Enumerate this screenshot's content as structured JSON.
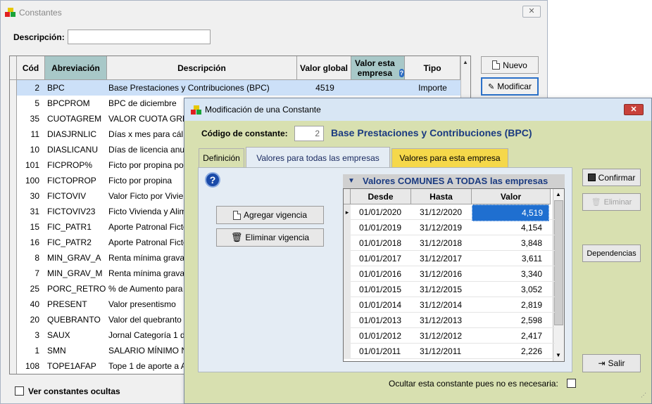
{
  "main_window": {
    "title": "Constantes",
    "descripcion_label": "Descripción:",
    "descripcion_value": "",
    "columns": [
      "Cód",
      "Abreviación",
      "Descripción",
      "Valor global",
      "Valor esta empresa",
      "Tipo"
    ],
    "rows": [
      {
        "cod": "2",
        "abrev": "BPC",
        "desc": "Base Prestaciones y Contribuciones (BPC)",
        "valor": "4519",
        "tipo": "Importe"
      },
      {
        "cod": "5",
        "abrev": "BPCPROM",
        "desc": "BPC de diciembre",
        "valor": "",
        "tipo": ""
      },
      {
        "cod": "35",
        "abrev": "CUOTAGREM",
        "desc": "VALOR CUOTA GRE",
        "valor": "",
        "tipo": ""
      },
      {
        "cod": "11",
        "abrev": "DIASJRNLIC",
        "desc": "Días x mes para cál",
        "valor": "",
        "tipo": ""
      },
      {
        "cod": "10",
        "abrev": "DIASLICANU",
        "desc": "Días de licencia anu",
        "valor": "",
        "tipo": ""
      },
      {
        "cod": "101",
        "abrev": "FICPROP%",
        "desc": "Ficto por propina po",
        "valor": "",
        "tipo": ""
      },
      {
        "cod": "100",
        "abrev": "FICTOPROP",
        "desc": "Ficto por propina",
        "valor": "",
        "tipo": ""
      },
      {
        "cod": "30",
        "abrev": "FICTOVIV",
        "desc": "Valor Ficto por Vivien",
        "valor": "",
        "tipo": ""
      },
      {
        "cod": "31",
        "abrev": "FICTOVIV23",
        "desc": "Ficto Vivienda y Alim",
        "valor": "",
        "tipo": ""
      },
      {
        "cod": "15",
        "abrev": "FIC_PATR1",
        "desc": "Aporte Patronal Ficto",
        "valor": "",
        "tipo": ""
      },
      {
        "cod": "16",
        "abrev": "FIC_PATR2",
        "desc": "Aporte Patronal Ficto",
        "valor": "",
        "tipo": ""
      },
      {
        "cod": "8",
        "abrev": "MIN_GRAV_A",
        "desc": "Renta mínima grava",
        "valor": "",
        "tipo": ""
      },
      {
        "cod": "7",
        "abrev": "MIN_GRAV_M",
        "desc": "Renta mínima grava",
        "valor": "",
        "tipo": ""
      },
      {
        "cod": "25",
        "abrev": "PORC_RETRO",
        "desc": "% de Aumento para",
        "valor": "",
        "tipo": ""
      },
      {
        "cod": "40",
        "abrev": "PRESENT",
        "desc": "Valor presentismo",
        "valor": "",
        "tipo": ""
      },
      {
        "cod": "20",
        "abrev": "QUEBRANTO",
        "desc": "Valor del quebranto",
        "valor": "",
        "tipo": ""
      },
      {
        "cod": "3",
        "abrev": "SAUX",
        "desc": "Jornal Categoría 1 d",
        "valor": "",
        "tipo": ""
      },
      {
        "cod": "1",
        "abrev": "SMN",
        "desc": "SALARIO MÍNIMO NA",
        "valor": "",
        "tipo": ""
      },
      {
        "cod": "108",
        "abrev": "TOPE1AFAP",
        "desc": "Tope 1 de aporte a A",
        "valor": "",
        "tipo": ""
      }
    ],
    "btn_nuevo": "Nuevo",
    "btn_modificar": "Modificar",
    "ver_ocultas_label": "Ver constantes ocultas"
  },
  "dialog": {
    "title": "Modificación de una Constante",
    "codigo_label": "Código de constante:",
    "codigo_value": "2",
    "constante_name": "Base Prestaciones y Contribuciones (BPC)",
    "tabs": [
      "Definición",
      "Valores para todas las empresas",
      "Valores para esta empresa"
    ],
    "btn_agregar": "Agregar vigencia",
    "btn_eliminar_vig": "Eliminar vigencia",
    "grid_title": "Valores COMUNES A TODAS las empresas",
    "grid_columns": [
      "Desde",
      "Hasta",
      "Valor"
    ],
    "grid_rows": [
      {
        "desde": "01/01/2020",
        "hasta": "31/12/2020",
        "valor": "4,519"
      },
      {
        "desde": "01/01/2019",
        "hasta": "31/12/2019",
        "valor": "4,154"
      },
      {
        "desde": "01/01/2018",
        "hasta": "31/12/2018",
        "valor": "3,848"
      },
      {
        "desde": "01/01/2017",
        "hasta": "31/12/2017",
        "valor": "3,611"
      },
      {
        "desde": "01/01/2016",
        "hasta": "31/12/2016",
        "valor": "3,340"
      },
      {
        "desde": "01/01/2015",
        "hasta": "31/12/2015",
        "valor": "3,052"
      },
      {
        "desde": "01/01/2014",
        "hasta": "31/12/2014",
        "valor": "2,819"
      },
      {
        "desde": "01/01/2013",
        "hasta": "31/12/2013",
        "valor": "2,598"
      },
      {
        "desde": "01/01/2012",
        "hasta": "31/12/2012",
        "valor": "2,417"
      },
      {
        "desde": "01/01/2011",
        "hasta": "31/12/2011",
        "valor": "2,226"
      }
    ],
    "btn_confirmar": "Confirmar",
    "btn_eliminar": "Eliminar",
    "btn_dependencias": "Dependencias",
    "btn_salir": "Salir",
    "ocultar_label": "Ocultar esta constante pues no es necesaria:"
  },
  "colors": {
    "selected_row": "#cce0f8",
    "dialog_bg": "#d8e0b0",
    "tab_active_yellow": "#f5d84a",
    "grid_title_bg": "#d0d0d0",
    "title_blue": "#1a3a80"
  }
}
